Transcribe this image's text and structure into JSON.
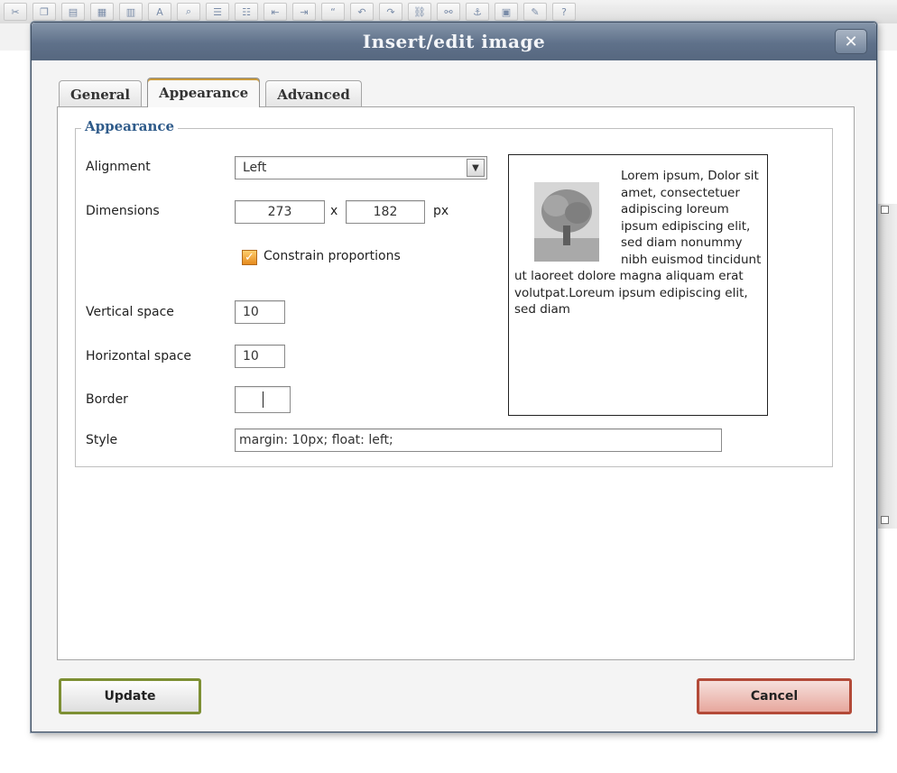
{
  "dialog": {
    "title": "Insert/edit image",
    "close_label": "✕"
  },
  "tabs": [
    {
      "label": "General"
    },
    {
      "label": "Appearance"
    },
    {
      "label": "Advanced"
    }
  ],
  "appearance": {
    "legend": "Appearance",
    "alignment_label": "Alignment",
    "alignment_value": "Left",
    "dimensions_label": "Dimensions",
    "width_value": "273",
    "times_sep": "x",
    "height_value": "182",
    "unit": "px",
    "constrain_label": "Constrain proportions",
    "constrain_checked": true,
    "vspace_label": "Vertical space",
    "vspace_value": "10",
    "hspace_label": "Horizontal space",
    "hspace_value": "10",
    "border_label": "Border",
    "border_value": "",
    "style_label": "Style",
    "style_value": "margin: 10px; float: left;"
  },
  "preview": {
    "text": "Lorem ipsum, Dolor sit amet, consectetuer adipiscing loreum ipsum edipiscing elit, sed diam nonummy nibh euismod tincidunt ut laoreet dolore magna aliquam erat volutpat.Loreum ipsum edipiscing elit, sed diam"
  },
  "buttons": {
    "update_label": "Update",
    "cancel_label": "Cancel"
  },
  "colors": {
    "titlebar": "#5f718a",
    "update_border": "#7d8f33",
    "cancel_border": "#b34a38",
    "checkbox": "#e58a1d"
  }
}
